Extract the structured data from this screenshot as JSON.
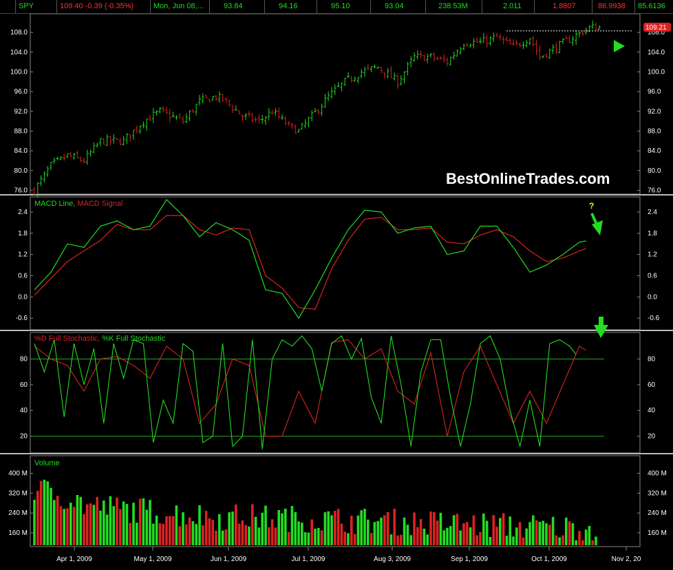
{
  "quote_bar": {
    "symbol": "SPY",
    "last_change": "109.40 -0.39 (-0.35%)",
    "date": "Mon, Jun 08,...",
    "open": "93.84",
    "high": "94.16",
    "low": "95.10",
    "close": "93.04",
    "volume": "238.53M",
    "v1": "2.011",
    "v2": "1.8807",
    "v3": "86.9938",
    "v4": "85.6136"
  },
  "colors": {
    "up": "#22dd22",
    "down": "#dd2222",
    "grid": "#22aa22",
    "macd_line": "#22dd22",
    "macd_signal": "#dd2222"
  },
  "watermark": "BestOnlineTrades.com",
  "x_axis_labels": [
    "Apr 1, 2009",
    "May 1, 2009",
    "Jun 1, 2009",
    "Jul 1, 2009",
    "Aug 3, 2009",
    "Sep 1, 2009",
    "Oct 1, 2009",
    "Nov 2, 20"
  ],
  "chart_data": [
    {
      "type": "candlestick",
      "symbol": "SPY",
      "y_ticks": [
        "76.0",
        "80.0",
        "84.0",
        "88.0",
        "92.0",
        "96.0",
        "100.0",
        "104.0",
        "108.0"
      ],
      "ylim": [
        75.5,
        111.5
      ],
      "last_price_label": "109.21",
      "price_anchors": [
        [
          0,
          76
        ],
        [
          5,
          81
        ],
        [
          10,
          83
        ],
        [
          15,
          82
        ],
        [
          20,
          86
        ],
        [
          27,
          86
        ],
        [
          33,
          90
        ],
        [
          38,
          92
        ],
        [
          45,
          90
        ],
        [
          50,
          94
        ],
        [
          55,
          95
        ],
        [
          58,
          94
        ],
        [
          63,
          91
        ],
        [
          68,
          90
        ],
        [
          72,
          92
        ],
        [
          77,
          89
        ],
        [
          80,
          88
        ],
        [
          84,
          91
        ],
        [
          89,
          95
        ],
        [
          94,
          98
        ],
        [
          99,
          100
        ],
        [
          104,
          101
        ],
        [
          110,
          98
        ],
        [
          115,
          103
        ],
        [
          120,
          103
        ],
        [
          125,
          102
        ],
        [
          130,
          106
        ],
        [
          135,
          106
        ],
        [
          140,
          107
        ],
        [
          145,
          105
        ],
        [
          150,
          107
        ],
        [
          153,
          103
        ],
        [
          158,
          105
        ],
        [
          163,
          107
        ],
        [
          168,
          109
        ],
        [
          172,
          109
        ]
      ],
      "resistance_level": 108.3
    },
    {
      "type": "line",
      "title": "MACD Line, MACD Signal",
      "y_ticks": [
        "-0.6",
        "0.0",
        "0.6",
        "1.2",
        "1.8",
        "2.4"
      ],
      "ylim": [
        -0.85,
        2.75
      ],
      "series": [
        {
          "name": "MACD Line",
          "anchors": [
            [
              0,
              0.2
            ],
            [
              5,
              0.7
            ],
            [
              10,
              1.5
            ],
            [
              15,
              1.4
            ],
            [
              20,
              2.0
            ],
            [
              25,
              2.15
            ],
            [
              30,
              1.9
            ],
            [
              35,
              2.0
            ],
            [
              40,
              2.75
            ],
            [
              45,
              2.3
            ],
            [
              50,
              1.7
            ],
            [
              55,
              2.1
            ],
            [
              60,
              1.9
            ],
            [
              65,
              1.6
            ],
            [
              70,
              0.2
            ],
            [
              75,
              0.1
            ],
            [
              80,
              -0.6
            ],
            [
              85,
              0.2
            ],
            [
              90,
              1.1
            ],
            [
              95,
              1.9
            ],
            [
              100,
              2.45
            ],
            [
              105,
              2.4
            ],
            [
              110,
              1.8
            ],
            [
              115,
              1.95
            ],
            [
              120,
              2.0
            ],
            [
              125,
              1.2
            ],
            [
              130,
              1.3
            ],
            [
              135,
              2.0
            ],
            [
              140,
              2.0
            ],
            [
              145,
              1.4
            ],
            [
              150,
              0.7
            ],
            [
              155,
              0.9
            ],
            [
              160,
              1.2
            ],
            [
              165,
              1.55
            ],
            [
              168,
              1.6
            ]
          ]
        },
        {
          "name": "MACD Signal",
          "anchors": [
            [
              0,
              0.05
            ],
            [
              10,
              1.0
            ],
            [
              20,
              1.6
            ],
            [
              25,
              2.05
            ],
            [
              30,
              1.9
            ],
            [
              35,
              1.9
            ],
            [
              40,
              2.3
            ],
            [
              45,
              2.3
            ],
            [
              50,
              1.9
            ],
            [
              55,
              1.75
            ],
            [
              60,
              1.95
            ],
            [
              65,
              1.9
            ],
            [
              70,
              0.6
            ],
            [
              75,
              0.25
            ],
            [
              80,
              -0.3
            ],
            [
              85,
              -0.35
            ],
            [
              90,
              0.8
            ],
            [
              95,
              1.6
            ],
            [
              100,
              2.2
            ],
            [
              105,
              2.25
            ],
            [
              110,
              1.9
            ],
            [
              115,
              1.9
            ],
            [
              120,
              1.95
            ],
            [
              125,
              1.55
            ],
            [
              130,
              1.5
            ],
            [
              135,
              1.75
            ],
            [
              140,
              1.9
            ],
            [
              145,
              1.7
            ],
            [
              150,
              1.3
            ],
            [
              155,
              1.0
            ],
            [
              160,
              1.1
            ],
            [
              165,
              1.3
            ],
            [
              168,
              1.4
            ]
          ]
        }
      ]
    },
    {
      "type": "line",
      "title": "%D Full Stochastic, %K Full Stochastic",
      "y_ticks": [
        "20",
        "40",
        "60",
        "80"
      ],
      "ylim": [
        8,
        99
      ],
      "reference_lines": [
        80,
        20
      ],
      "series": [
        {
          "name": "%D Full Stochastic",
          "anchors": [
            [
              0,
              90
            ],
            [
              5,
              80
            ],
            [
              10,
              75
            ],
            [
              15,
              55
            ],
            [
              20,
              80
            ],
            [
              25,
              82
            ],
            [
              30,
              75
            ],
            [
              35,
              65
            ],
            [
              40,
              90
            ],
            [
              45,
              80
            ],
            [
              50,
              30
            ],
            [
              55,
              45
            ],
            [
              60,
              80
            ],
            [
              65,
              75
            ],
            [
              70,
              20
            ],
            [
              75,
              20
            ],
            [
              80,
              55
            ],
            [
              85,
              30
            ],
            [
              90,
              93
            ],
            [
              95,
              95
            ],
            [
              100,
              80
            ],
            [
              105,
              88
            ],
            [
              110,
              55
            ],
            [
              115,
              45
            ],
            [
              120,
              85
            ],
            [
              125,
              20
            ],
            [
              130,
              70
            ],
            [
              135,
              90
            ],
            [
              140,
              60
            ],
            [
              145,
              30
            ],
            [
              150,
              55
            ],
            [
              155,
              30
            ],
            [
              160,
              60
            ],
            [
              165,
              90
            ],
            [
              168,
              85
            ]
          ]
        },
        {
          "name": "%K Full Stochastic",
          "anchors": [
            [
              0,
              92
            ],
            [
              3,
              70
            ],
            [
              6,
              95
            ],
            [
              9,
              35
            ],
            [
              12,
              92
            ],
            [
              15,
              60
            ],
            [
              18,
              88
            ],
            [
              21,
              30
            ],
            [
              24,
              92
            ],
            [
              27,
              65
            ],
            [
              30,
              95
            ],
            [
              33,
              92
            ],
            [
              36,
              15
            ],
            [
              39,
              48
            ],
            [
              42,
              30
            ],
            [
              45,
              92
            ],
            [
              48,
              86
            ],
            [
              51,
              15
            ],
            [
              54,
              20
            ],
            [
              57,
              92
            ],
            [
              60,
              12
            ],
            [
              63,
              20
            ],
            [
              66,
              95
            ],
            [
              69,
              10
            ],
            [
              72,
              80
            ],
            [
              75,
              95
            ],
            [
              78,
              90
            ],
            [
              81,
              98
            ],
            [
              84,
              88
            ],
            [
              87,
              55
            ],
            [
              90,
              92
            ],
            [
              93,
              98
            ],
            [
              96,
              80
            ],
            [
              99,
              96
            ],
            [
              102,
              50
            ],
            [
              105,
              30
            ],
            [
              108,
              98
            ],
            [
              111,
              60
            ],
            [
              114,
              12
            ],
            [
              117,
              70
            ],
            [
              120,
              95
            ],
            [
              123,
              95
            ],
            [
              126,
              50
            ],
            [
              129,
              12
            ],
            [
              132,
              45
            ],
            [
              135,
              92
            ],
            [
              138,
              98
            ],
            [
              141,
              80
            ],
            [
              144,
              40
            ],
            [
              147,
              12
            ],
            [
              150,
              48
            ],
            [
              153,
              12
            ],
            [
              156,
              92
            ],
            [
              159,
              95
            ],
            [
              162,
              90
            ],
            [
              165,
              80
            ]
          ]
        }
      ]
    },
    {
      "type": "bar",
      "title": "Volume",
      "y_ticks": [
        "160 M",
        "240 M",
        "320 M",
        "400 M"
      ],
      "ylim": [
        110,
        460
      ],
      "approx_daily_volume_range_M": [
        130,
        460
      ]
    }
  ]
}
